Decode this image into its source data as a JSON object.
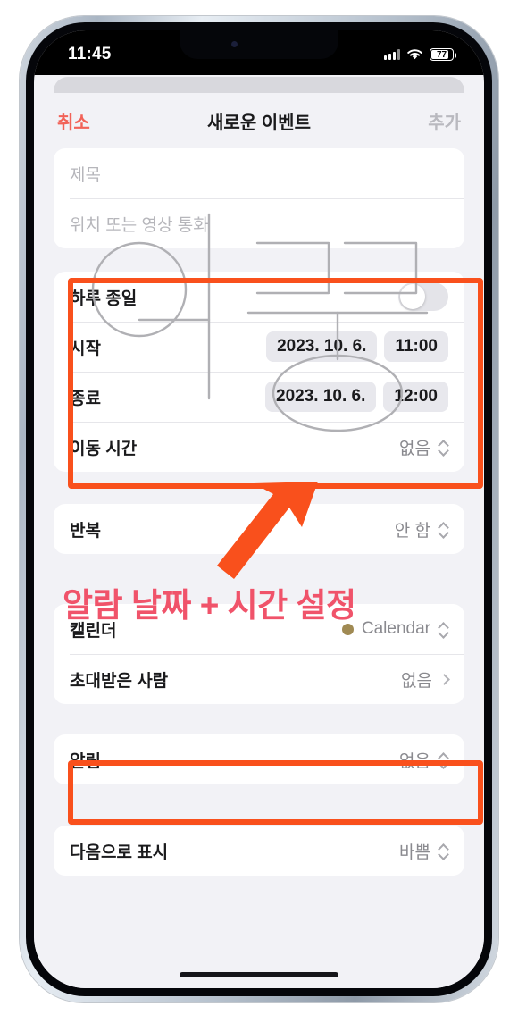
{
  "status_bar": {
    "time": "11:45",
    "battery_percent": "77",
    "signal_icon": "cellular-bars-icon",
    "wifi_icon": "wifi-icon",
    "battery_icon": "battery-icon"
  },
  "nav": {
    "cancel_label": "취소",
    "title": "새로운 이벤트",
    "add_label": "추가"
  },
  "form": {
    "title_placeholder": "제목",
    "location_placeholder": "위치 또는 영상 통화"
  },
  "datetime_group": {
    "all_day": {
      "label": "하루 종일",
      "toggle_on": false
    },
    "start": {
      "label": "시작",
      "date": "2023. 10. 6.",
      "time": "11:00"
    },
    "end": {
      "label": "종료",
      "date": "2023. 10. 6.",
      "time": "12:00"
    },
    "travel": {
      "label": "이동 시간",
      "value": "없음"
    }
  },
  "repeat_group": {
    "repeat": {
      "label": "반복",
      "value": "안 함"
    }
  },
  "calendar_group": {
    "calendar": {
      "label": "캘린더",
      "value": "Calendar",
      "dot_color": "#a08a53"
    },
    "invitees": {
      "label": "초대받은 사람",
      "value": "없음"
    }
  },
  "alert_group": {
    "alert": {
      "label": "알림",
      "value": "없음"
    }
  },
  "showas_group": {
    "show_as": {
      "label": "다음으로 표시",
      "value": "바쁨"
    }
  },
  "annotation": {
    "text": "알람 날짜 + 시간 설정",
    "text_color": "#f0536a",
    "box_color": "#f9501c",
    "arrow_color": "#f9501c"
  },
  "watermark": {
    "text": "아꾸"
  },
  "colors": {
    "cancel_red": "#f26257",
    "screen_bg": "#f2f2f6",
    "card_bg": "#ffffff",
    "secondary_text": "#8a8a8f"
  }
}
